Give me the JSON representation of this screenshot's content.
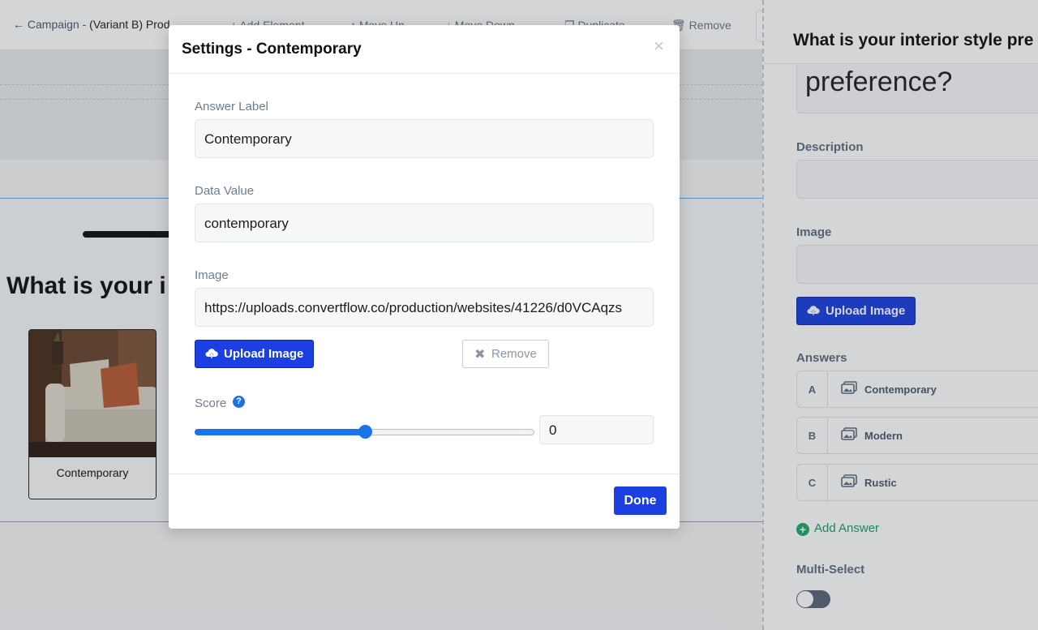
{
  "topbar": {
    "campaign_link": "← Campaign - ",
    "variant_name": "(Variant B) Prod",
    "add_element": "Add Element",
    "move_up": "Move Up",
    "move_down": "Move Down",
    "duplicate": "Duplicate",
    "remove": "Remove"
  },
  "canvas": {
    "heading": "What is your i",
    "answer_card_caption": "Contemporary"
  },
  "sidebar": {
    "title": "What is your interior style pre",
    "question_text": "preference?",
    "description_label": "Description",
    "image_label": "Image",
    "upload_image_label": "Upload Image",
    "answers_label": "Answers",
    "answers": [
      {
        "letter": "A",
        "label": "Contemporary"
      },
      {
        "letter": "B",
        "label": "Modern"
      },
      {
        "letter": "C",
        "label": "Rustic"
      }
    ],
    "add_answer_label": "Add Answer",
    "multi_select_label": "Multi-Select",
    "multi_select_on": false
  },
  "modal": {
    "title": "Settings - Contemporary",
    "close_glyph": "×",
    "answer_label_label": "Answer Label",
    "answer_label_value": "Contemporary",
    "data_value_label": "Data Value",
    "data_value_value": "contemporary",
    "image_label": "Image",
    "image_url": "https://uploads.convertflow.co/production/websites/41226/d0VCAqzs",
    "upload_image_label": "Upload Image",
    "remove_label": "Remove",
    "score_label": "Score",
    "score_help_glyph": "?",
    "score_value": "0",
    "slider_fraction": 0.5,
    "done_label": "Done"
  },
  "colors": {
    "primary_button": "#1b3fe0",
    "slider_accent": "#1a73e8",
    "add_answer_green": "#1d9d66",
    "overlay": "rgba(40,44,52,0.20)"
  }
}
